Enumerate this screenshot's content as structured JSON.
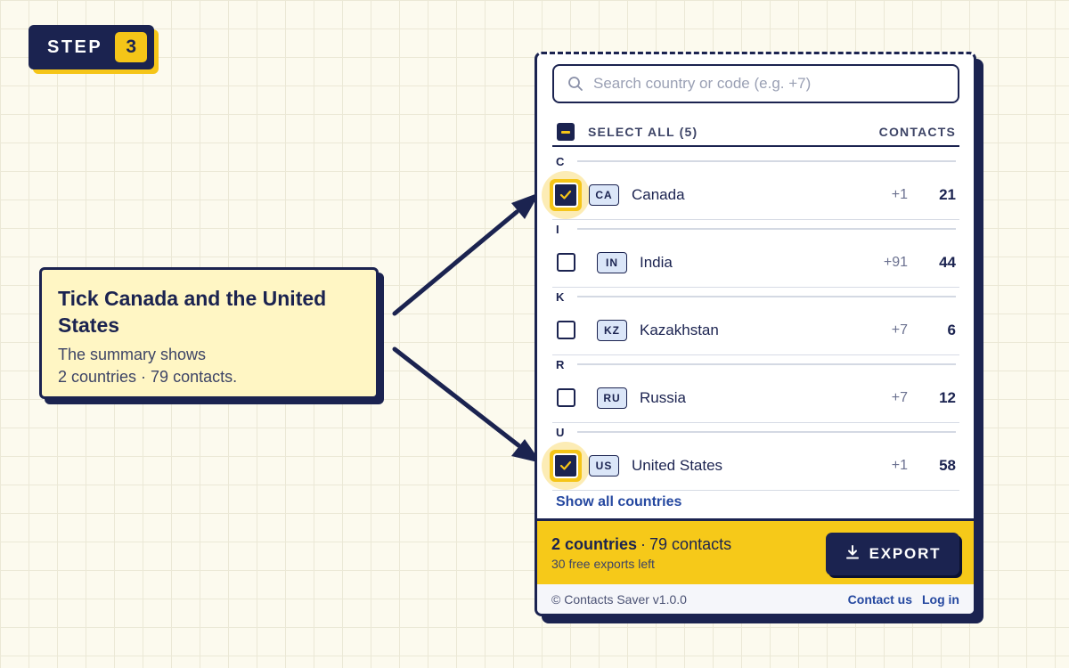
{
  "step": {
    "label": "STEP",
    "number": "3"
  },
  "callout": {
    "title": "Tick Canada and the United States",
    "body_line1": "The summary shows",
    "body_line2": "2 countries · 79 contacts."
  },
  "search": {
    "placeholder": "Search country or code (e.g. +7)",
    "value": ""
  },
  "list_header": {
    "select_all": "SELECT ALL (5)",
    "contacts": "CONTACTS",
    "state": "indeterminate"
  },
  "groups": [
    {
      "letter": "C",
      "country": {
        "code": "CA",
        "name": "Canada",
        "dial": "+1",
        "contacts": "21",
        "checked": true
      }
    },
    {
      "letter": "I",
      "country": {
        "code": "IN",
        "name": "India",
        "dial": "+91",
        "contacts": "44",
        "checked": false
      }
    },
    {
      "letter": "K",
      "country": {
        "code": "KZ",
        "name": "Kazakhstan",
        "dial": "+7",
        "contacts": "6",
        "checked": false
      }
    },
    {
      "letter": "R",
      "country": {
        "code": "RU",
        "name": "Russia",
        "dial": "+7",
        "contacts": "12",
        "checked": false
      }
    },
    {
      "letter": "U",
      "country": {
        "code": "US",
        "name": "United States",
        "dial": "+1",
        "contacts": "58",
        "checked": true
      }
    }
  ],
  "show_all": "Show all countries",
  "summary": {
    "countries": "2 countries",
    "separator": "·",
    "contacts": "79 contacts",
    "free_exports": "30 free exports left",
    "export_label": "EXPORT"
  },
  "footer": {
    "copyright": "© Contacts Saver v1.0.0",
    "contact": "Contact us",
    "login": "Log in"
  },
  "colors": {
    "navy": "#1b2350",
    "yellow": "#f5c518",
    "link": "#2548a0",
    "cream": "#fff6c4"
  },
  "icons": {
    "search": "search-icon",
    "export": "download-icon",
    "check": "check-icon"
  }
}
